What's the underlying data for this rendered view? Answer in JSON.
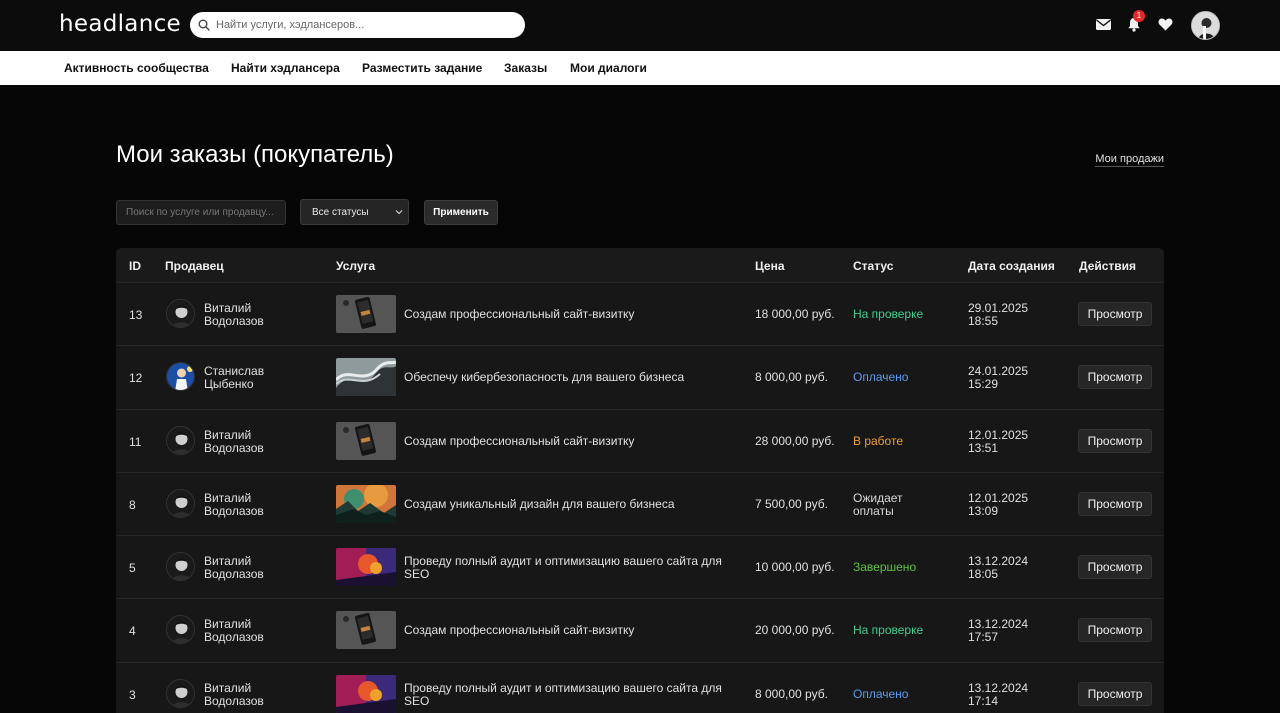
{
  "header": {
    "logo": "headlance",
    "search_placeholder": "Найти услуги, хэдлансеров...",
    "notifications_count": "1",
    "icons": [
      "mail-icon",
      "bell-icon",
      "heart-icon",
      "avatar"
    ]
  },
  "nav": {
    "items": [
      {
        "label": "Активность сообщества"
      },
      {
        "label": "Найти хэдлансера"
      },
      {
        "label": "Разместить задание"
      },
      {
        "label": "Заказы"
      },
      {
        "label": "Мои диалоги"
      }
    ]
  },
  "main": {
    "title": "Мои заказы (покупатель)",
    "my_sales_link": "Мои продажи",
    "filter": {
      "search_placeholder": "Поиск по услуге или продавцу...",
      "status_selected": "Все статусы",
      "apply_label": "Применить"
    },
    "table": {
      "headers": {
        "id": "ID",
        "seller": "Продавец",
        "service": "Услуга",
        "price": "Цена",
        "status": "Статус",
        "date": "Дата создания",
        "actions": "Действия"
      },
      "rows": [
        {
          "id": "13",
          "seller_first": "Виталий",
          "seller_last": "Водолазов",
          "service": "Создам профессиональный сайт-визитку",
          "price": "18 000,00 руб.",
          "status": "На проверке",
          "status_color": "#3ecf8e",
          "date": "29.01.2025",
          "time": "18:55",
          "action": "Просмотр",
          "thumb": "phone"
        },
        {
          "id": "12",
          "seller_first": "Станислав",
          "seller_last": "Цыбенко",
          "service": "Обеспечу кибербезопасность для вашего бизнеса",
          "price": "8 000,00 руб.",
          "status": "Оплачено",
          "status_color": "#5b9cf0",
          "date": "24.01.2025",
          "time": "15:29",
          "action": "Просмотр",
          "thumb": "wave"
        },
        {
          "id": "11",
          "seller_first": "Виталий",
          "seller_last": "Водолазов",
          "service": "Создам профессиональный сайт-визитку",
          "price": "28 000,00 руб.",
          "status": "В работе",
          "status_color": "#f0a030",
          "date": "12.01.2025",
          "time": "13:51",
          "action": "Просмотр",
          "thumb": "phone"
        },
        {
          "id": "8",
          "seller_first": "Виталий",
          "seller_last": "Водолазов",
          "service": "Создам уникальный дизайн для вашего бизнеса",
          "price": "7 500,00 руб.",
          "status": "Ожидает оплаты",
          "status_color": "#d8d8d8",
          "date": "12.01.2025",
          "time": "13:09",
          "action": "Просмотр",
          "thumb": "landscape"
        },
        {
          "id": "5",
          "seller_first": "Виталий",
          "seller_last": "Водолазов",
          "service": "Проведу полный аудит и оптимизацию вашего сайта для SEO",
          "price": "10 000,00 руб.",
          "status": "Завершено",
          "status_color": "#5cc43a",
          "date": "13.12.2024",
          "time": "18:05",
          "action": "Просмотр",
          "thumb": "colorful"
        },
        {
          "id": "4",
          "seller_first": "Виталий",
          "seller_last": "Водолазов",
          "service": "Создам профессиональный сайт-визитку",
          "price": "20 000,00 руб.",
          "status": "На проверке",
          "status_color": "#3ecf8e",
          "date": "13.12.2024",
          "time": "17:57",
          "action": "Просмотр",
          "thumb": "phone"
        },
        {
          "id": "3",
          "seller_first": "Виталий",
          "seller_last": "Водолазов",
          "service": "Проведу полный аудит и оптимизацию вашего сайта для SEO",
          "price": "8 000,00 руб.",
          "status": "Оплачено",
          "status_color": "#5b9cf0",
          "date": "13.12.2024",
          "time": "17:14",
          "action": "Просмотр",
          "thumb": "colorful"
        }
      ]
    }
  }
}
